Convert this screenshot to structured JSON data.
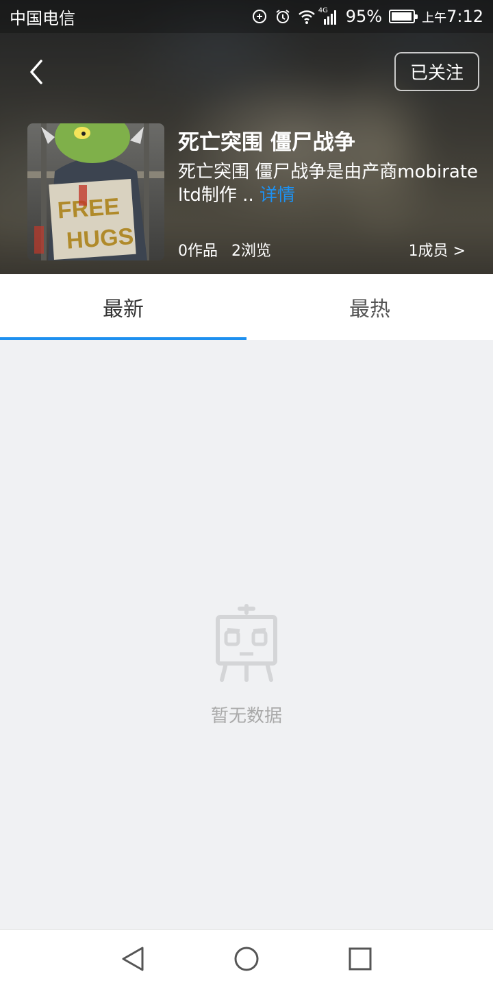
{
  "status_bar": {
    "carrier": "中国电信",
    "network": "4G",
    "battery": "95%",
    "time_prefix": "上午",
    "time": "7:12",
    "icons": [
      "data-sync-icon",
      "alarm-icon",
      "wifi-icon",
      "signal-icon",
      "battery-icon"
    ]
  },
  "header": {
    "back_icon": "back-chevron-icon",
    "follow_label": "已关注"
  },
  "game": {
    "title": "死亡突围 僵尸战争",
    "description": "死亡突围 僵尸战争是由产商mobirate ltd制作 ..",
    "more_link": "详情",
    "works": "0作品",
    "views": "2浏览",
    "members": "1成员 >",
    "cover_text": "FREE HUGS"
  },
  "tabs": [
    {
      "label": "最新",
      "active": true
    },
    {
      "label": "最热",
      "active": false
    }
  ],
  "empty_state": {
    "icon": "empty-tv-robot-icon",
    "text": "暂无数据"
  },
  "nav_bar": {
    "back": "nav-back-icon",
    "home": "nav-home-icon",
    "recents": "nav-recents-icon"
  },
  "colors": {
    "accent": "#1e90ef",
    "background": "#f0f1f3",
    "empty_text": "#aaaaaa"
  }
}
